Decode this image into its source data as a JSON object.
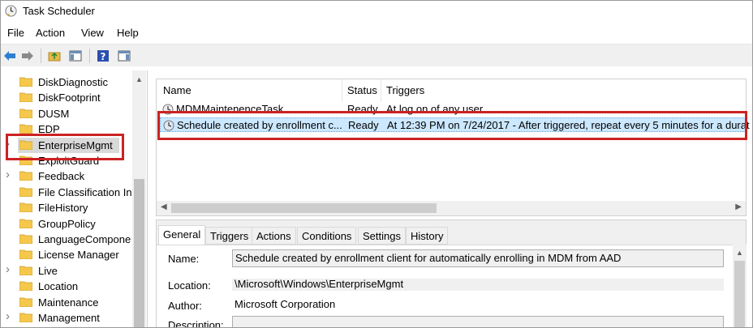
{
  "window": {
    "title": "Task Scheduler"
  },
  "menu": [
    "File",
    "Action",
    "View",
    "Help"
  ],
  "toolbar": {
    "icons": [
      "back-arrow-icon",
      "forward-arrow-icon",
      "up-folder-icon",
      "show-hide-console-tree-icon",
      "help-icon",
      "show-hide-action-pane-icon"
    ]
  },
  "tree": {
    "items": [
      {
        "label": "DiskDiagnostic",
        "expandable": false
      },
      {
        "label": "DiskFootprint",
        "expandable": false
      },
      {
        "label": "DUSM",
        "expandable": false
      },
      {
        "label": "EDP",
        "expandable": false
      },
      {
        "label": "EnterpriseMgmt",
        "expandable": true,
        "selected": true
      },
      {
        "label": "ExploitGuard",
        "expandable": false
      },
      {
        "label": "Feedback",
        "expandable": true
      },
      {
        "label": "File Classification In",
        "expandable": false
      },
      {
        "label": "FileHistory",
        "expandable": false
      },
      {
        "label": "GroupPolicy",
        "expandable": false
      },
      {
        "label": "LanguageCompone",
        "expandable": false
      },
      {
        "label": "License Manager",
        "expandable": false
      },
      {
        "label": "Live",
        "expandable": true
      },
      {
        "label": "Location",
        "expandable": false
      },
      {
        "label": "Maintenance",
        "expandable": false
      },
      {
        "label": "Management",
        "expandable": true
      }
    ]
  },
  "tasklist": {
    "columns": [
      "Name",
      "Status",
      "Triggers"
    ],
    "rows": [
      {
        "name": "MDMMaintenenceTask",
        "status": "Ready",
        "triggers": "At log on of any user"
      },
      {
        "name": "Schedule created by enrollment c...",
        "status": "Ready",
        "triggers": "At 12:39 PM on 7/24/2017 - After triggered, repeat every 5 minutes for a durat",
        "selected": true
      }
    ]
  },
  "details": {
    "tabs": [
      "General",
      "Triggers",
      "Actions",
      "Conditions",
      "Settings",
      "History"
    ],
    "active_tab": "General",
    "fields": {
      "name_label": "Name:",
      "name_value": "Schedule created by enrollment client for automatically enrolling in MDM from AAD",
      "location_label": "Location:",
      "location_value": "\\Microsoft\\Windows\\EnterpriseMgmt",
      "author_label": "Author:",
      "author_value": "Microsoft Corporation",
      "description_label": "Description:"
    }
  },
  "colors": {
    "highlight_border": "#cc2222",
    "selection": "#cce8ff",
    "folder": "#f5c84c"
  }
}
